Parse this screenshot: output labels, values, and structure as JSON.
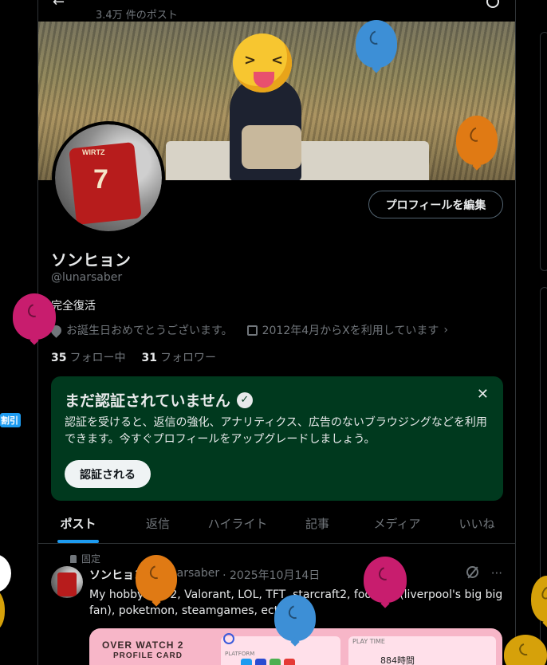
{
  "header": {
    "back_icon": "arrow-left-icon",
    "post_count": "3.4万 件のポスト",
    "search_icon": "search-icon"
  },
  "profile": {
    "name": "ソンヒョン",
    "handle": "@lunarsaber",
    "bio": "完全復活",
    "location": "お誕生日おめでとうございます。",
    "joined": "2012年4月からXを利用しています",
    "following_count": "35",
    "following_label": "フォロー中",
    "followers_count": "31",
    "followers_label": "フォロワー",
    "edit_button": "プロフィールを編集",
    "avatar_shirt_name": "WIRTZ",
    "avatar_shirt_number": "7"
  },
  "verification": {
    "title": "まだ認証されていません",
    "badge_icon": "verified-check-icon",
    "close_icon": "close-icon",
    "text": "認証を受けると、返信の強化、アナリティクス、広告のないブラウジングなどを利用できます。今すぐプロフィールをアップグレードしましょう。",
    "button": "認証される"
  },
  "tabs": [
    {
      "label": "ポスト",
      "active": true
    },
    {
      "label": "返信",
      "active": false
    },
    {
      "label": "ハイライト",
      "active": false
    },
    {
      "label": "記事",
      "active": false
    },
    {
      "label": "メディア",
      "active": false
    },
    {
      "label": "いいね",
      "active": false
    }
  ],
  "pinned_post": {
    "pinned_label": "固定",
    "author": "ソンヒョン",
    "handle": "@lunarsaber",
    "date": "· 2025年10月14日",
    "text": "My hobby: OW2, Valorant, LOL, TFT, starcraft2, football (liverpool's big big fan), poketmon, steamgames, ect",
    "more_icon": "more-dots-icon",
    "grok_icon": "grok-icon",
    "card": {
      "title": "OVER WATCH 2",
      "subtitle": "PROFILE CARD",
      "platform_label": "PLATFORM",
      "playtime_label": "PLAY TIME",
      "playtime_value": "884時間"
    }
  },
  "left_rail": {
    "label": "割引"
  },
  "colors": {
    "accent": "#1d9bf0",
    "verify_bg": "#00391e",
    "text": "#e7e9ea",
    "muted": "#71767b",
    "border": "#2f3336"
  }
}
